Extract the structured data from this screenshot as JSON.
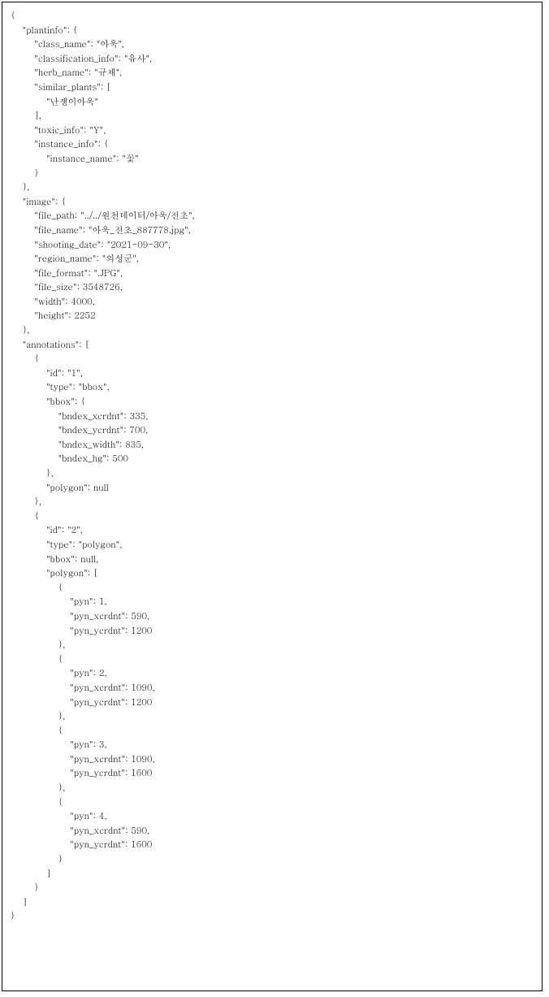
{
  "lines": [
    "{",
    "    \"plantinfo\": {",
    "        \"class_name\": \"아욱\",",
    "        \"classification_info\": \"유사\",",
    "        \"herb_name\": \"규채\",",
    "        \"similar_plants\": [",
    "            \"난쟁이아욱\"",
    "        ],",
    "        \"toxic_info\": \"Y\",",
    "        \"instance_info\": {",
    "            \"instance_name\": \"꽃\"",
    "        }",
    "    },",
    "    \"image\": {",
    "        \"file_path: \"../../원천데이터/아욱/전초\",",
    "        \"file_name\": \"아욱_전초_887778.jpg\",",
    "        \"shooting_date\": \"2021-09-30\",",
    "        \"region_name\": \"의성군\",",
    "        \"file_format\": \".JPG\",",
    "        \"file_size\": 3548726,",
    "        \"width\": 4000,",
    "        \"height\": 2252",
    "    },",
    "    \"annotations\": [",
    "        {",
    "            \"id\": \"1\",",
    "            \"type\": \"bbox\",",
    "            \"bbox\": {",
    "                \"bndex_xcrdnt\": 335,",
    "                \"bndex_ycrdnt\": 700,",
    "                \"bndex_width\": 835,",
    "                \"bndex_hg\": 500",
    "            },",
    "            \"polygon\": null",
    "        },",
    "        {",
    "            \"id\": \"2\",",
    "            \"type\": \"polygon\",",
    "            \"bbox\": null,",
    "            \"polygon\": [",
    "                {",
    "                    \"pyn\": 1,",
    "                    \"pyn_xcrdnt\": 590,",
    "                    \"pyn_ycrdnt\": 1200",
    "                },",
    "                {",
    "                    \"pyn\": 2,",
    "                    \"pyn_xcrdnt\": 1090,",
    "                    \"pyn_ycrdnt\": 1200",
    "                },",
    "                {",
    "                    \"pyn\": 3,",
    "                    \"pyn_xcrdnt\": 1090,",
    "                    \"pyn_ycrdnt\": 1600",
    "                },",
    "                {",
    "                    \"pyn\": 4,",
    "                    \"pyn_xcrdnt\": 590,",
    "                    \"pyn_ycrdnt\": 1600",
    "                }",
    "            ]",
    "        }",
    "    ]",
    "}"
  ]
}
